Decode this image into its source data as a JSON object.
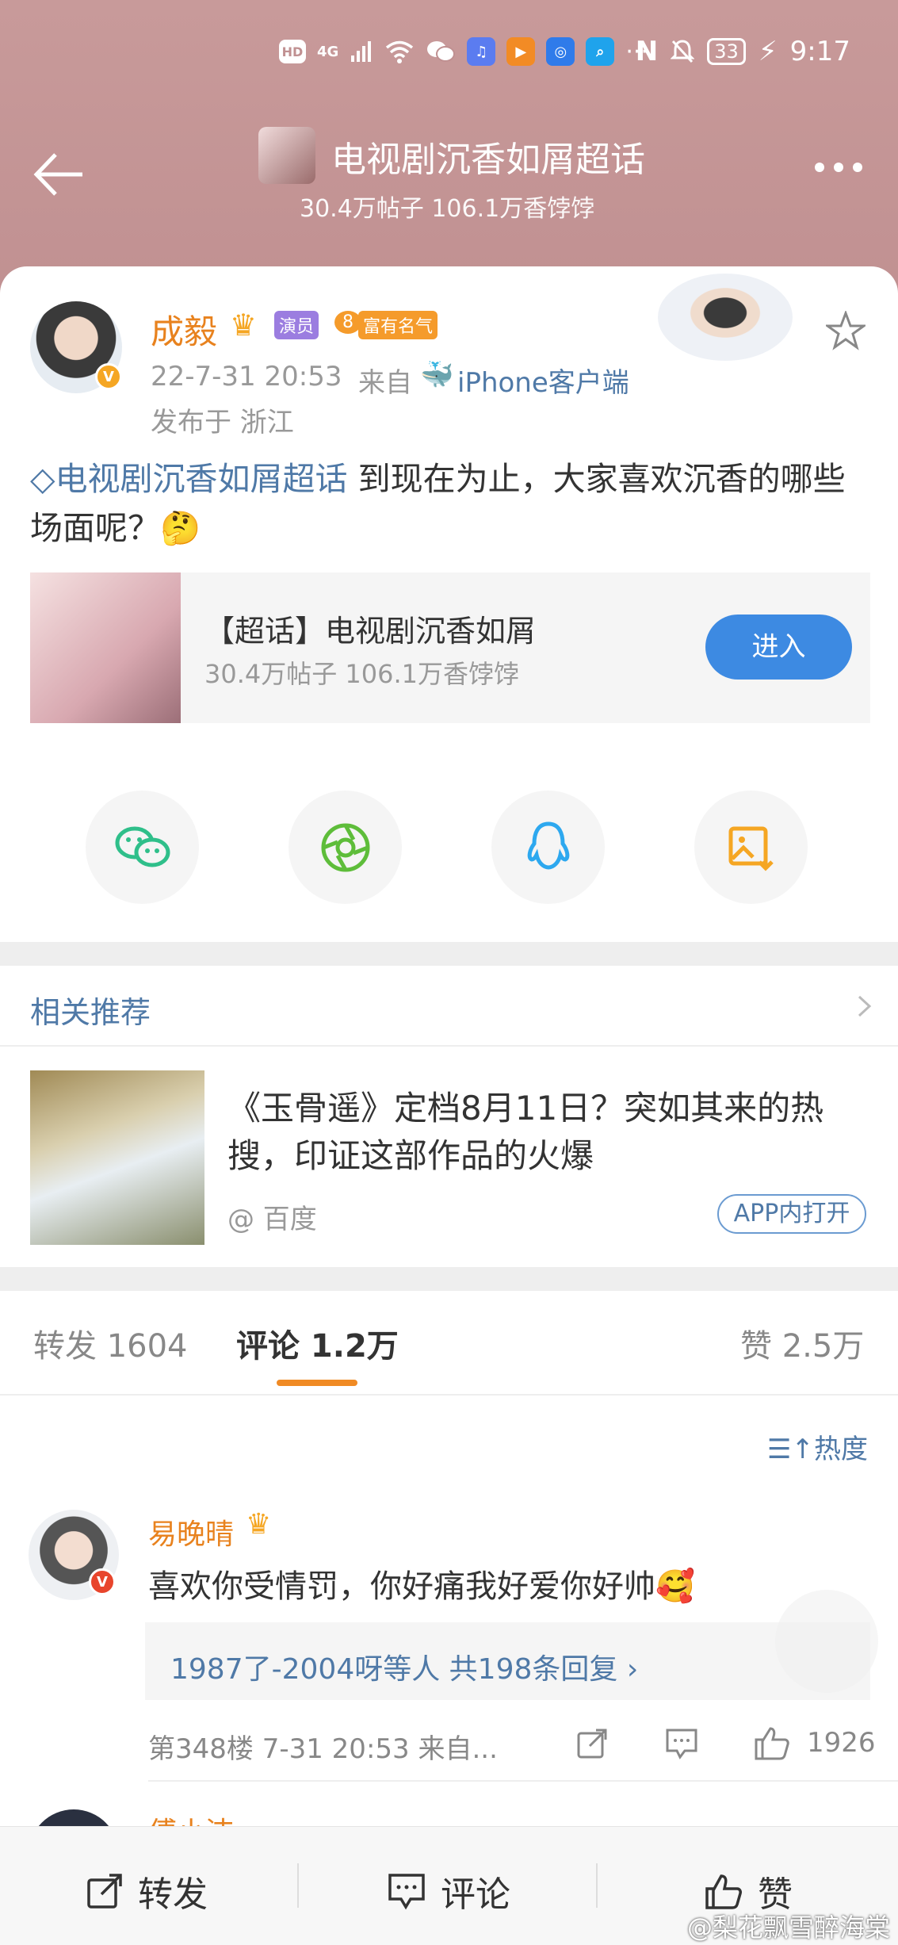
{
  "status_bar": {
    "left_icons": [
      "HD",
      "4G",
      "signal-icon",
      "wifi-icon",
      "wechat-icon",
      "music-app-icon",
      "video-app-icon",
      "bulb-app-icon",
      "search-app-icon",
      "···"
    ],
    "nfc": "N",
    "battery": "33",
    "time": "9:17"
  },
  "header": {
    "title": "电视剧沉香如屑超话",
    "subtitle": "30.4万帖子 106.1万香饽饽"
  },
  "post": {
    "author": "成毅",
    "tag_actor": "演员",
    "tag_level": "8",
    "tag_fame": "富有名气",
    "time": "22-7-31 20:53",
    "source_prefix": "来自",
    "source": "iPhone客户端",
    "location": "发布于 浙江",
    "topic_link": "电视剧沉香如屑超话",
    "text": "到现在为止，大家喜欢沉香的哪些场面呢？🤔",
    "super_card": {
      "title": "【超话】电视剧沉香如屑",
      "subtitle": "30.4万帖子 106.1万香饽饽",
      "enter": "进入"
    }
  },
  "share": [
    "wechat-icon",
    "moments-icon",
    "qq-icon",
    "save-image-icon"
  ],
  "recommend": {
    "heading": "相关推荐",
    "item_title": "《玉骨遥》定档8月11日？突如其来的热搜，印证这部作品的火爆",
    "item_source": "@ 百度",
    "app_open": "APP内打开"
  },
  "tabs": {
    "repost": "转发 1604",
    "comment": "评论 1.2万",
    "like": "赞 2.5万"
  },
  "sort_label": "热度",
  "comment": {
    "author": "易晚晴",
    "text": "喜欢你受情罚，你好痛我好爱你好帅🥰",
    "reply_summary": "1987了-2004呀等人  共198条回复 ›",
    "meta": "第348楼 7-31 20:53 来自...",
    "likes": "1926",
    "next_author": "傅小洁"
  },
  "bottom_bar": {
    "repost": "转发",
    "comment": "评论",
    "like": "赞"
  },
  "watermark": "@梨花飘雪醉海棠",
  "colors": {
    "header_bg": "#c09091",
    "accent_orange": "#e8821e",
    "link_blue": "#4f79a7",
    "enter_blue": "#3d8ae2"
  }
}
